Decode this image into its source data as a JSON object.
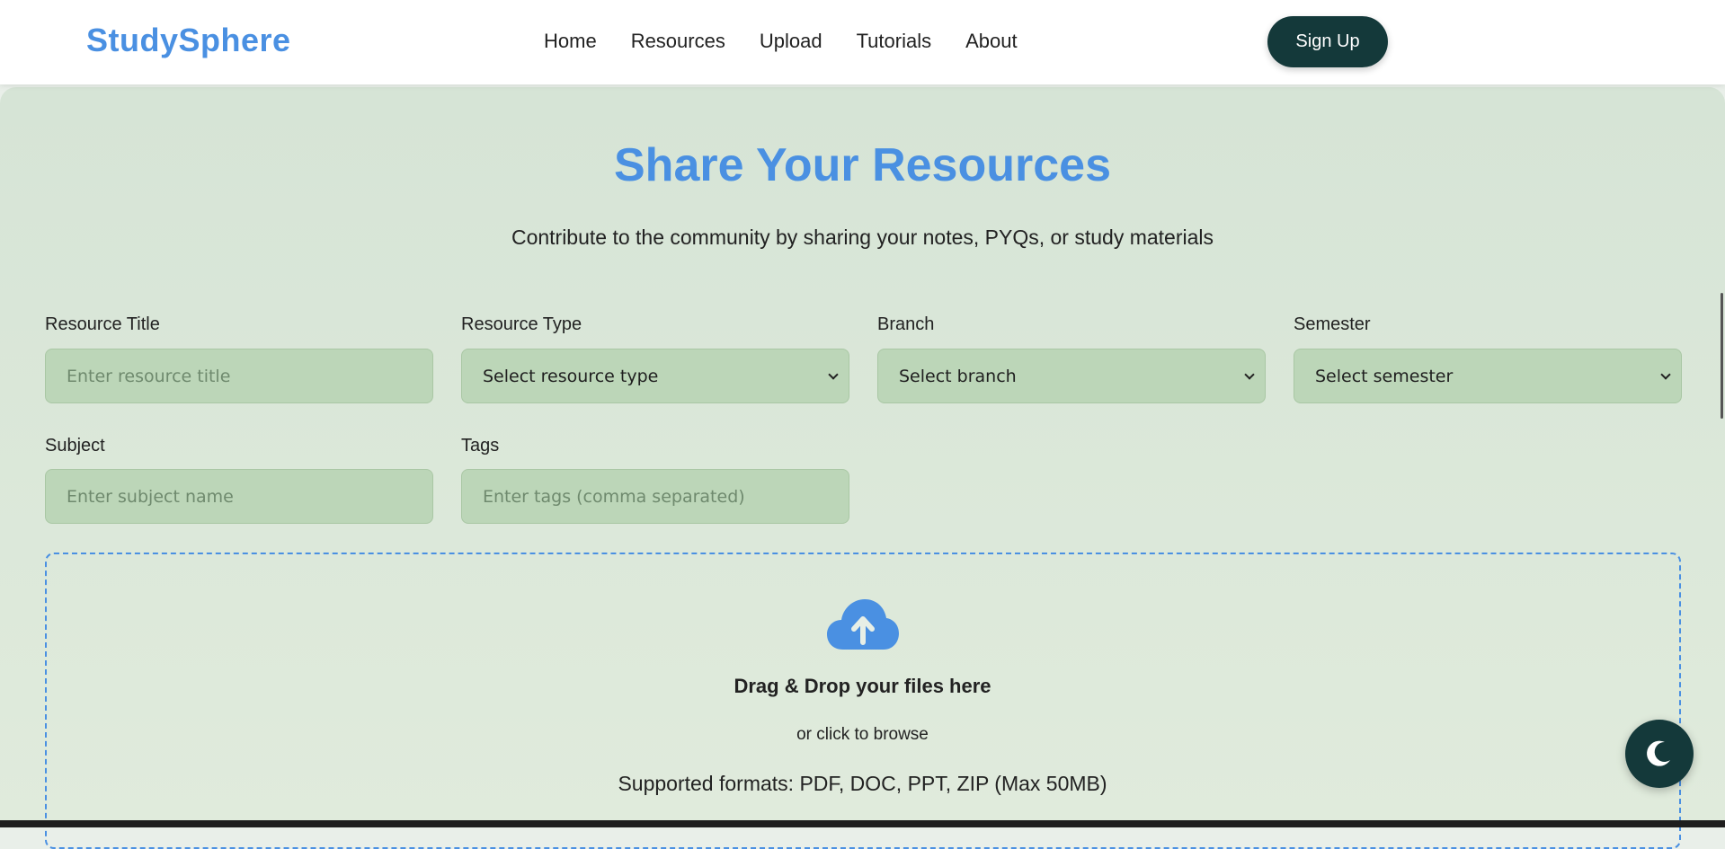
{
  "header": {
    "logo": "StudySphere",
    "nav": [
      "Home",
      "Resources",
      "Upload",
      "Tutorials",
      "About"
    ],
    "signup_label": "Sign Up"
  },
  "main": {
    "title": "Share Your Resources",
    "subtitle": "Contribute to the community by sharing your notes, PYQs, or study materials"
  },
  "form": {
    "resource_title": {
      "label": "Resource Title",
      "placeholder": "Enter resource title"
    },
    "resource_type": {
      "label": "Resource Type",
      "value": "Select resource type"
    },
    "branch": {
      "label": "Branch",
      "value": "Select branch"
    },
    "semester": {
      "label": "Semester",
      "value": "Select semester"
    },
    "subject": {
      "label": "Subject",
      "placeholder": "Enter subject name"
    },
    "tags": {
      "label": "Tags",
      "placeholder": "Enter tags (comma separated)"
    }
  },
  "upload": {
    "icon": "cloud-upload-icon",
    "title": "Drag & Drop your files here",
    "subtitle": "or click to browse",
    "formats": "Supported formats: PDF, DOC, PPT, ZIP (Max 50MB)"
  },
  "theme_toggle": {
    "icon": "moon-icon"
  },
  "colors": {
    "accent": "#4a90e2",
    "dark": "#14393a",
    "panel": "#d6e4d6",
    "field": "#bcd6b8"
  }
}
